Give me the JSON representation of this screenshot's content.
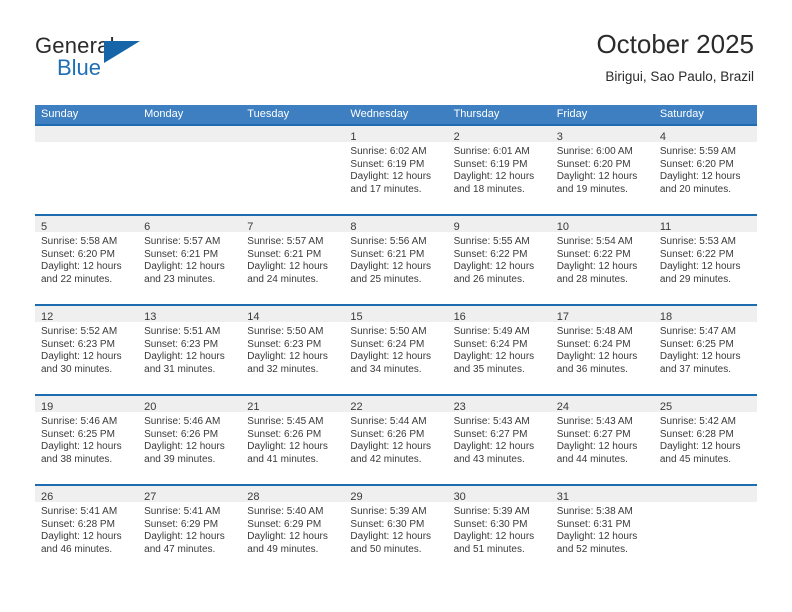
{
  "brand": {
    "word_general": "General",
    "word_blue": "Blue",
    "flag_icon": "triangle-flag-icon"
  },
  "header": {
    "month_title": "October 2025",
    "location": "Birigui, Sao Paulo, Brazil"
  },
  "colors": {
    "header_blue": "#3d7fc1",
    "row_rule_blue": "#1d6cb0",
    "day_band_gray": "#efefef",
    "brand_blue": "#1f6fb5",
    "text": "#3a3a3a"
  },
  "calendar": {
    "weekdays": [
      "Sunday",
      "Monday",
      "Tuesday",
      "Wednesday",
      "Thursday",
      "Friday",
      "Saturday"
    ],
    "weeks": [
      [
        {
          "day": "",
          "lines": []
        },
        {
          "day": "",
          "lines": []
        },
        {
          "day": "",
          "lines": []
        },
        {
          "day": "1",
          "lines": [
            "Sunrise: 6:02 AM",
            "Sunset: 6:19 PM",
            "Daylight: 12 hours",
            "and 17 minutes."
          ]
        },
        {
          "day": "2",
          "lines": [
            "Sunrise: 6:01 AM",
            "Sunset: 6:19 PM",
            "Daylight: 12 hours",
            "and 18 minutes."
          ]
        },
        {
          "day": "3",
          "lines": [
            "Sunrise: 6:00 AM",
            "Sunset: 6:20 PM",
            "Daylight: 12 hours",
            "and 19 minutes."
          ]
        },
        {
          "day": "4",
          "lines": [
            "Sunrise: 5:59 AM",
            "Sunset: 6:20 PM",
            "Daylight: 12 hours",
            "and 20 minutes."
          ]
        }
      ],
      [
        {
          "day": "5",
          "lines": [
            "Sunrise: 5:58 AM",
            "Sunset: 6:20 PM",
            "Daylight: 12 hours",
            "and 22 minutes."
          ]
        },
        {
          "day": "6",
          "lines": [
            "Sunrise: 5:57 AM",
            "Sunset: 6:21 PM",
            "Daylight: 12 hours",
            "and 23 minutes."
          ]
        },
        {
          "day": "7",
          "lines": [
            "Sunrise: 5:57 AM",
            "Sunset: 6:21 PM",
            "Daylight: 12 hours",
            "and 24 minutes."
          ]
        },
        {
          "day": "8",
          "lines": [
            "Sunrise: 5:56 AM",
            "Sunset: 6:21 PM",
            "Daylight: 12 hours",
            "and 25 minutes."
          ]
        },
        {
          "day": "9",
          "lines": [
            "Sunrise: 5:55 AM",
            "Sunset: 6:22 PM",
            "Daylight: 12 hours",
            "and 26 minutes."
          ]
        },
        {
          "day": "10",
          "lines": [
            "Sunrise: 5:54 AM",
            "Sunset: 6:22 PM",
            "Daylight: 12 hours",
            "and 28 minutes."
          ]
        },
        {
          "day": "11",
          "lines": [
            "Sunrise: 5:53 AM",
            "Sunset: 6:22 PM",
            "Daylight: 12 hours",
            "and 29 minutes."
          ]
        }
      ],
      [
        {
          "day": "12",
          "lines": [
            "Sunrise: 5:52 AM",
            "Sunset: 6:23 PM",
            "Daylight: 12 hours",
            "and 30 minutes."
          ]
        },
        {
          "day": "13",
          "lines": [
            "Sunrise: 5:51 AM",
            "Sunset: 6:23 PM",
            "Daylight: 12 hours",
            "and 31 minutes."
          ]
        },
        {
          "day": "14",
          "lines": [
            "Sunrise: 5:50 AM",
            "Sunset: 6:23 PM",
            "Daylight: 12 hours",
            "and 32 minutes."
          ]
        },
        {
          "day": "15",
          "lines": [
            "Sunrise: 5:50 AM",
            "Sunset: 6:24 PM",
            "Daylight: 12 hours",
            "and 34 minutes."
          ]
        },
        {
          "day": "16",
          "lines": [
            "Sunrise: 5:49 AM",
            "Sunset: 6:24 PM",
            "Daylight: 12 hours",
            "and 35 minutes."
          ]
        },
        {
          "day": "17",
          "lines": [
            "Sunrise: 5:48 AM",
            "Sunset: 6:24 PM",
            "Daylight: 12 hours",
            "and 36 minutes."
          ]
        },
        {
          "day": "18",
          "lines": [
            "Sunrise: 5:47 AM",
            "Sunset: 6:25 PM",
            "Daylight: 12 hours",
            "and 37 minutes."
          ]
        }
      ],
      [
        {
          "day": "19",
          "lines": [
            "Sunrise: 5:46 AM",
            "Sunset: 6:25 PM",
            "Daylight: 12 hours",
            "and 38 minutes."
          ]
        },
        {
          "day": "20",
          "lines": [
            "Sunrise: 5:46 AM",
            "Sunset: 6:26 PM",
            "Daylight: 12 hours",
            "and 39 minutes."
          ]
        },
        {
          "day": "21",
          "lines": [
            "Sunrise: 5:45 AM",
            "Sunset: 6:26 PM",
            "Daylight: 12 hours",
            "and 41 minutes."
          ]
        },
        {
          "day": "22",
          "lines": [
            "Sunrise: 5:44 AM",
            "Sunset: 6:26 PM",
            "Daylight: 12 hours",
            "and 42 minutes."
          ]
        },
        {
          "day": "23",
          "lines": [
            "Sunrise: 5:43 AM",
            "Sunset: 6:27 PM",
            "Daylight: 12 hours",
            "and 43 minutes."
          ]
        },
        {
          "day": "24",
          "lines": [
            "Sunrise: 5:43 AM",
            "Sunset: 6:27 PM",
            "Daylight: 12 hours",
            "and 44 minutes."
          ]
        },
        {
          "day": "25",
          "lines": [
            "Sunrise: 5:42 AM",
            "Sunset: 6:28 PM",
            "Daylight: 12 hours",
            "and 45 minutes."
          ]
        }
      ],
      [
        {
          "day": "26",
          "lines": [
            "Sunrise: 5:41 AM",
            "Sunset: 6:28 PM",
            "Daylight: 12 hours",
            "and 46 minutes."
          ]
        },
        {
          "day": "27",
          "lines": [
            "Sunrise: 5:41 AM",
            "Sunset: 6:29 PM",
            "Daylight: 12 hours",
            "and 47 minutes."
          ]
        },
        {
          "day": "28",
          "lines": [
            "Sunrise: 5:40 AM",
            "Sunset: 6:29 PM",
            "Daylight: 12 hours",
            "and 49 minutes."
          ]
        },
        {
          "day": "29",
          "lines": [
            "Sunrise: 5:39 AM",
            "Sunset: 6:30 PM",
            "Daylight: 12 hours",
            "and 50 minutes."
          ]
        },
        {
          "day": "30",
          "lines": [
            "Sunrise: 5:39 AM",
            "Sunset: 6:30 PM",
            "Daylight: 12 hours",
            "and 51 minutes."
          ]
        },
        {
          "day": "31",
          "lines": [
            "Sunrise: 5:38 AM",
            "Sunset: 6:31 PM",
            "Daylight: 12 hours",
            "and 52 minutes."
          ]
        },
        {
          "day": "",
          "lines": []
        }
      ]
    ]
  }
}
